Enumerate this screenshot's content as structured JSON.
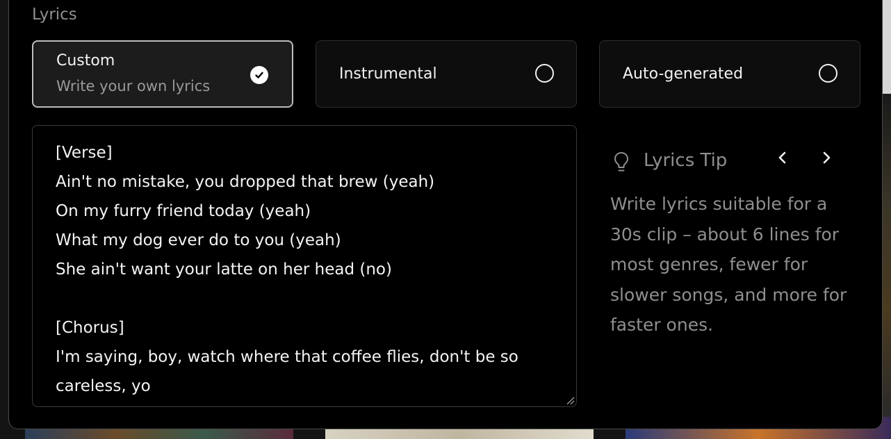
{
  "section": {
    "label": "Lyrics"
  },
  "options": [
    {
      "title": "Custom",
      "subtitle": "Write your own lyrics",
      "selected": true
    },
    {
      "title": "Instrumental",
      "selected": false
    },
    {
      "title": "Auto-generated",
      "selected": false
    }
  ],
  "lyrics": {
    "value": "[Verse]\nAin't no mistake, you dropped that brew (yeah)\nOn my furry friend today (yeah)\nWhat my dog ever do to you (yeah)\nShe ain't want your latte on her head (no)\n\n[Chorus]\nI'm saying, boy, watch where that coffee flies, don't be so careless, yo"
  },
  "tip": {
    "title": "Lyrics Tip",
    "body": "Write lyrics suitable for a 30s clip – about 6 lines for most genres, fewer for slower songs, and more for faster ones.",
    "icon": "lightbulb-icon"
  },
  "colors": {
    "selected_border": "#bdbdbd",
    "muted_text": "#8f8f8f",
    "panel_bg": "#000000"
  }
}
